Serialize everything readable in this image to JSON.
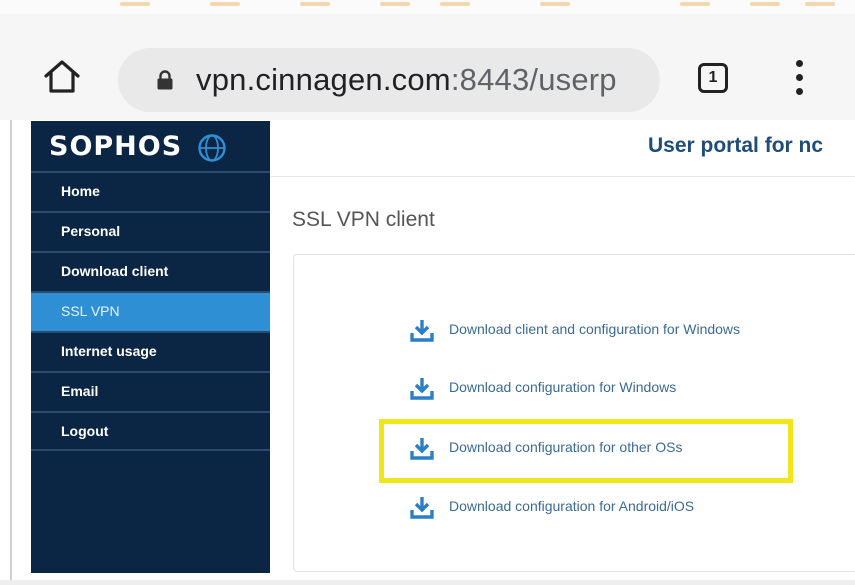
{
  "browser": {
    "url_domain": "vpn.cinnagen.com",
    "url_path": ":8443/userp",
    "tab_count": "1",
    "icons": {
      "home": "home-icon",
      "lock": "lock-icon",
      "tabs": "tabs-counter-icon",
      "menu": "more-vert-icon"
    }
  },
  "sidebar": {
    "logo_text": "SOPHOS",
    "logo_icon": "sophos-globe-icon",
    "items": [
      {
        "label": "Home",
        "active": false
      },
      {
        "label": "Personal",
        "active": false
      },
      {
        "label": "Download client",
        "active": false
      },
      {
        "label": "SSL VPN",
        "active": true
      },
      {
        "label": "Internet usage",
        "active": false
      },
      {
        "label": "Email",
        "active": false
      },
      {
        "label": "Logout",
        "active": false
      }
    ]
  },
  "main": {
    "portal_title": "User portal for nc",
    "section_title": "SSL VPN client",
    "downloads": [
      {
        "label": "Download client and configuration for Windows",
        "icon": "download-icon",
        "highlighted": false
      },
      {
        "label": "Download configuration for Windows",
        "icon": "download-icon",
        "highlighted": false
      },
      {
        "label": "Download configuration for other OSs",
        "icon": "download-icon",
        "highlighted": true
      },
      {
        "label": "Download configuration for Android/iOS",
        "icon": "download-icon",
        "highlighted": false
      }
    ]
  },
  "colors": {
    "sidebar_bg": "#0b2545",
    "sidebar_active": "#2e8fd4",
    "link": "#3a6a96",
    "download_icon": "#2a7fc6",
    "highlight": "#f3e51c",
    "portal_title": "#1e4d7a"
  }
}
